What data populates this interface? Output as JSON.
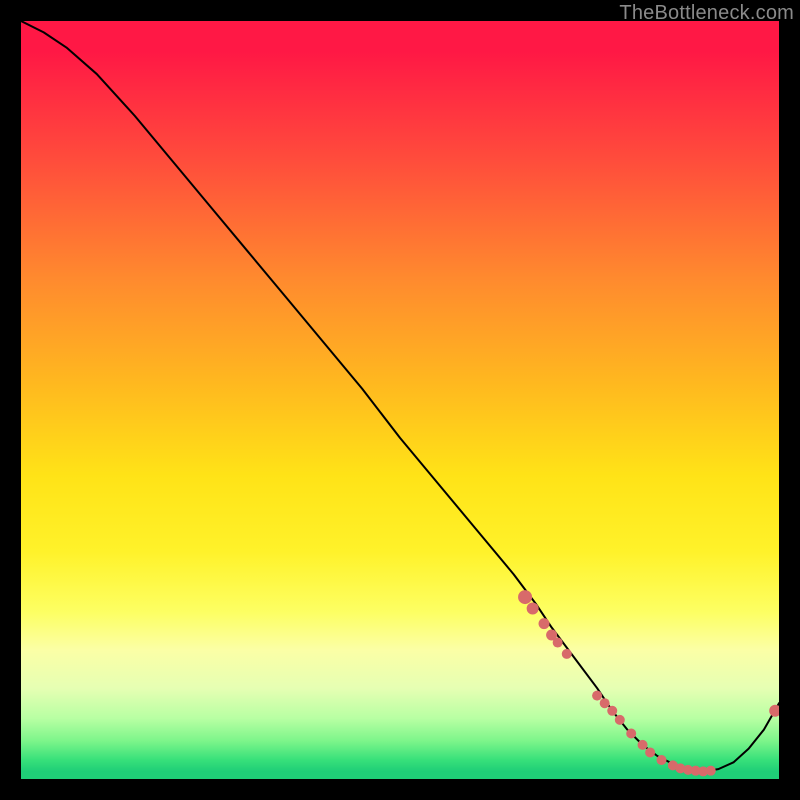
{
  "watermark": {
    "text": "TheBottleneck.com"
  },
  "chart_data": {
    "type": "line",
    "title": "",
    "xlabel": "",
    "ylabel": "",
    "xlim": [
      0,
      100
    ],
    "ylim": [
      0,
      100
    ],
    "series": [
      {
        "name": "bottleneck-curve",
        "x": [
          0,
          3,
          6,
          10,
          15,
          20,
          25,
          30,
          35,
          40,
          45,
          50,
          55,
          60,
          65,
          68,
          70,
          73,
          76,
          78,
          80,
          82,
          84,
          86,
          88,
          90,
          92,
          94,
          96,
          98,
          100
        ],
        "y": [
          100,
          98.5,
          96.5,
          93,
          87.5,
          81.5,
          75.5,
          69.5,
          63.5,
          57.5,
          51.5,
          45,
          39,
          33,
          27,
          23,
          20,
          16,
          12,
          9,
          6.5,
          4.5,
          3,
          2,
          1.3,
          1,
          1.3,
          2.2,
          4,
          6.5,
          10
        ]
      }
    ],
    "markers": {
      "name": "highlight-points",
      "color": "#d86a6a",
      "x": [
        66.5,
        67.5,
        69,
        70,
        70.8,
        72,
        76,
        77,
        78,
        79,
        80.5,
        82,
        83,
        84.5,
        86,
        87,
        88,
        89,
        90,
        91,
        99.5
      ],
      "y": [
        24,
        22.5,
        20.5,
        19,
        18,
        16.5,
        11,
        10,
        9,
        7.8,
        6,
        4.5,
        3.5,
        2.5,
        1.8,
        1.4,
        1.2,
        1.1,
        1,
        1.1,
        9
      ],
      "r": [
        7,
        6,
        5.5,
        5.5,
        5,
        5,
        5,
        5,
        5,
        5,
        5,
        5,
        5,
        5,
        5,
        5,
        5,
        5,
        5,
        5,
        6
      ]
    },
    "background_gradient": {
      "top": "#ff1845",
      "mid": "#fff22a",
      "bottom": "#1fce77"
    }
  }
}
